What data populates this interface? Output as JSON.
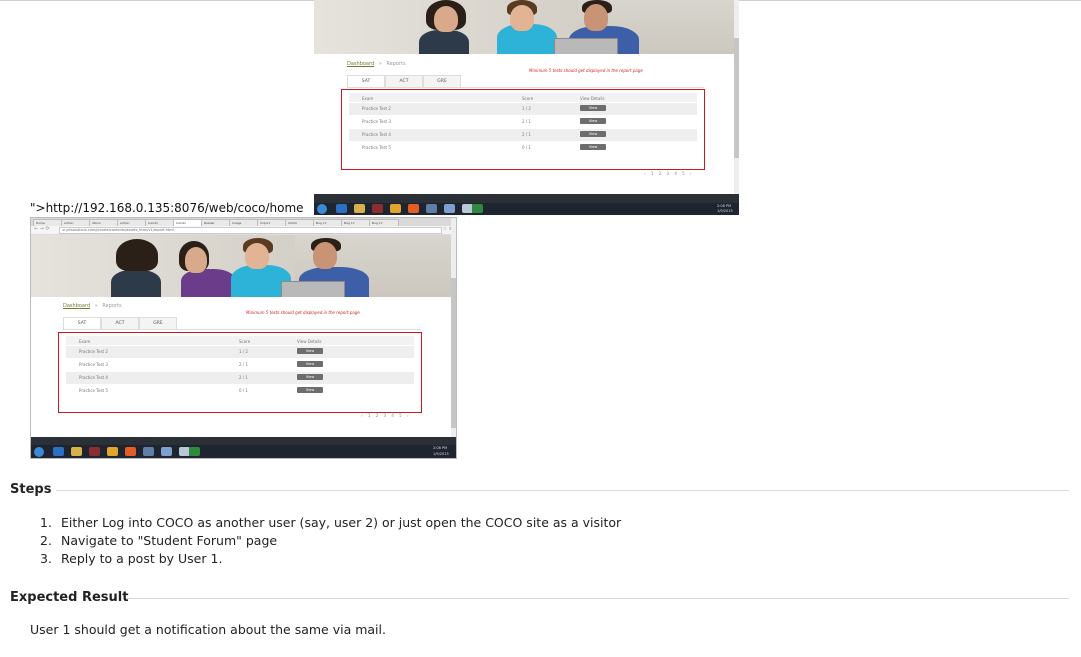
{
  "report_page": {
    "breadcrumb_root": "Dashboard",
    "breadcrumb_current": "Reports",
    "note": "Minimum 5 tests should get displayed in the report page",
    "tabs": [
      "SAT",
      "ACT",
      "GRE"
    ],
    "columns": {
      "exam": "Exam",
      "score": "Score",
      "details": "View Details"
    },
    "rows": [
      {
        "exam": "Practice Test 2",
        "score": "1 / 2",
        "action": "View"
      },
      {
        "exam": "Practice Test 3",
        "score": "2 / 1",
        "action": "View"
      },
      {
        "exam": "Practice Test 4",
        "score": "2 / 1",
        "action": "View"
      },
      {
        "exam": "Practice Test 5",
        "score": "0 / 1",
        "action": "View"
      }
    ],
    "pager": "‹ 1 2 3 4 5 ›"
  },
  "browser": {
    "tabs": [
      "Home",
      "admin",
      "Yahoo",
      "admin",
      "Cambr",
      "Cambr",
      "Reader",
      "Image",
      "Import",
      "COCO",
      "Bug 17",
      "Bug 17",
      "Bug 17"
    ],
    "url": "ui.pitsolutions.com/private/contents/assets_html/v1/report.html"
  },
  "taskbar": {
    "time": "2:08 PM",
    "date": "1/9/2015"
  },
  "stray_text": "\">http://192.168.0.135:8076/web/coco/home",
  "steps": {
    "title": "Steps",
    "items": [
      {
        "n": "1.",
        "text": "Either Log into COCO as another user (say, user 2) or just open the COCO site as a visitor"
      },
      {
        "n": "2.",
        "text": "Navigate to \"Student Forum\" page"
      },
      {
        "n": "3.",
        "text": "Reply to a post by User 1."
      }
    ]
  },
  "expected": {
    "title": "Expected Result",
    "text": "User 1 should get a notification about the same via mail."
  }
}
